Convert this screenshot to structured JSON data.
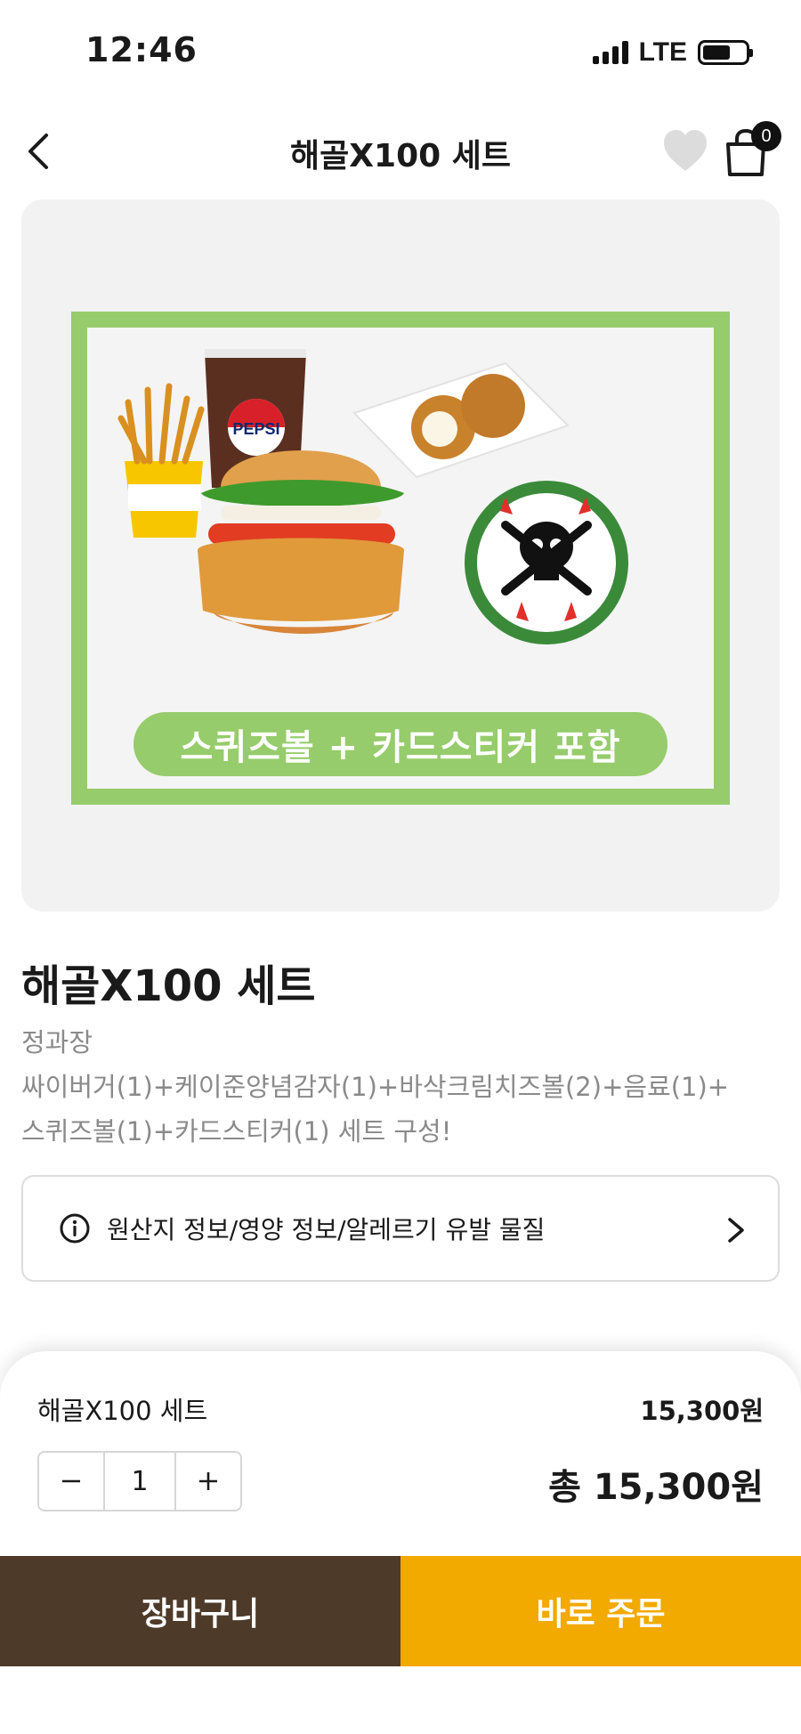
{
  "status_bar": {
    "time": "12:46",
    "network": "LTE",
    "battery_level": 0.66
  },
  "nav": {
    "title": "해골X100 세트",
    "cart_count": "0",
    "back_icon": "chevron-left-icon",
    "favorite_icon": "heart-icon",
    "cart_icon": "shopping-bag-icon"
  },
  "hero": {
    "banner_text": "스퀴즈볼 + 카드스티커 포함",
    "brand_accent": "#96cc6b"
  },
  "product": {
    "name": "해골X100 세트",
    "desc_lines": [
      "정과장",
      "싸이버거(1)+케이준양념감자(1)+바삭크림치즈볼(2)+음료(1)+",
      "스퀴즈볼(1)+카드스티커(1) 세트 구성!"
    ]
  },
  "info": {
    "label": "원산지 정보/영양 정보/알레르기 유발 물질",
    "icon": "info-icon"
  },
  "sheet": {
    "item_name": "해골X100 세트",
    "item_price": "15,300원",
    "quantity": "1",
    "total": "총 15,300원"
  },
  "actions": {
    "cart_label": "장바구니",
    "order_label": "바로 주문",
    "cart_color": "#4e3a29",
    "order_color": "#f2a900"
  }
}
